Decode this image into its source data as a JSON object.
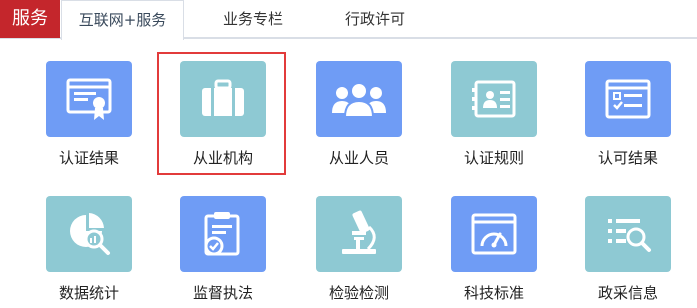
{
  "brand": {
    "label": "服务"
  },
  "tabs": [
    {
      "label": "互联网+服务",
      "active": true
    },
    {
      "label": "业务专栏",
      "active": false
    },
    {
      "label": "行政许可",
      "active": false
    }
  ],
  "tiles": [
    {
      "label": "认证结果",
      "icon": "certificate-icon",
      "color": "#6f9cf5"
    },
    {
      "label": "从业机构",
      "icon": "briefcase-icon",
      "color": "#8ec9d3",
      "selected": true
    },
    {
      "label": "从业人员",
      "icon": "people-group-icon",
      "color": "#6f9cf5"
    },
    {
      "label": "认证规则",
      "icon": "id-card-icon",
      "color": "#8ec9d3"
    },
    {
      "label": "认可结果",
      "icon": "checklist-window-icon",
      "color": "#6f9cf5"
    },
    {
      "label": "数据统计",
      "icon": "chart-magnifier-icon",
      "color": "#8ec9d3"
    },
    {
      "label": "监督执法",
      "icon": "clipboard-check-icon",
      "color": "#6f9cf5"
    },
    {
      "label": "检验检测",
      "icon": "microscope-icon",
      "color": "#8ec9d3"
    },
    {
      "label": "科技标准",
      "icon": "gauge-window-icon",
      "color": "#6f9cf5"
    },
    {
      "label": "政采信息",
      "icon": "list-search-icon",
      "color": "#8ec9d3"
    }
  ]
}
